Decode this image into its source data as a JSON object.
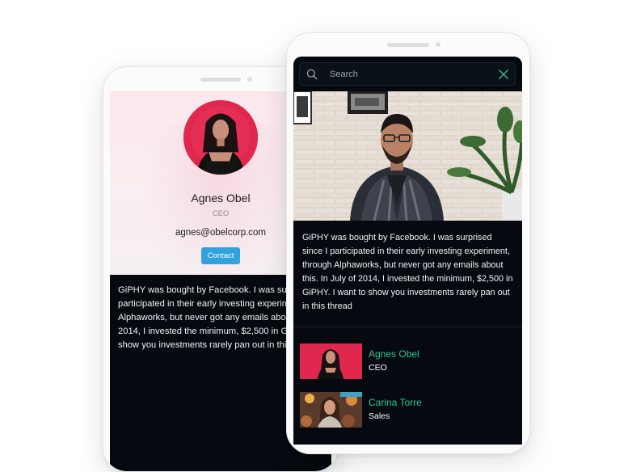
{
  "profile": {
    "name": "Agnes Obel",
    "role": "CEO",
    "email": "agnes@obelcorp.com",
    "contact_label": "Contact"
  },
  "post_text": "GiPHY was bought by Facebook. I was surprised since I participated in their early investing experiment, through Alphaworks, but never got any emails about this. In July of 2014, I invested the minimum, $2,500 in GiPHY. I want to show you investments rarely pan out in this thread",
  "search": {
    "placeholder": "Search"
  },
  "users": [
    {
      "name": "Agnes Obel",
      "role": "CEO"
    },
    {
      "name": "Carina Torre",
      "role": "Sales"
    }
  ],
  "colors": {
    "accent_green": "#2bc38e",
    "contact_blue": "#31a2dd",
    "screen_dark": "#060a10",
    "avatar_pink": "#e0284f"
  },
  "icons": {
    "search": "search-icon",
    "close": "close-icon"
  }
}
